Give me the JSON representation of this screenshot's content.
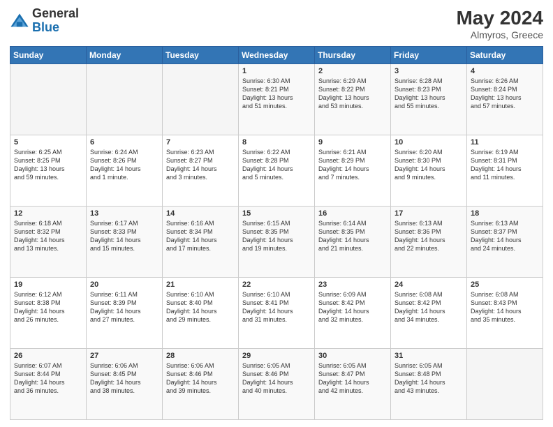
{
  "header": {
    "logo_general": "General",
    "logo_blue": "Blue",
    "title": "May 2024",
    "location": "Almyros, Greece"
  },
  "days_of_week": [
    "Sunday",
    "Monday",
    "Tuesday",
    "Wednesday",
    "Thursday",
    "Friday",
    "Saturday"
  ],
  "weeks": [
    [
      {
        "day": "",
        "info": ""
      },
      {
        "day": "",
        "info": ""
      },
      {
        "day": "",
        "info": ""
      },
      {
        "day": "1",
        "info": "Sunrise: 6:30 AM\nSunset: 8:21 PM\nDaylight: 13 hours\nand 51 minutes."
      },
      {
        "day": "2",
        "info": "Sunrise: 6:29 AM\nSunset: 8:22 PM\nDaylight: 13 hours\nand 53 minutes."
      },
      {
        "day": "3",
        "info": "Sunrise: 6:28 AM\nSunset: 8:23 PM\nDaylight: 13 hours\nand 55 minutes."
      },
      {
        "day": "4",
        "info": "Sunrise: 6:26 AM\nSunset: 8:24 PM\nDaylight: 13 hours\nand 57 minutes."
      }
    ],
    [
      {
        "day": "5",
        "info": "Sunrise: 6:25 AM\nSunset: 8:25 PM\nDaylight: 13 hours\nand 59 minutes."
      },
      {
        "day": "6",
        "info": "Sunrise: 6:24 AM\nSunset: 8:26 PM\nDaylight: 14 hours\nand 1 minute."
      },
      {
        "day": "7",
        "info": "Sunrise: 6:23 AM\nSunset: 8:27 PM\nDaylight: 14 hours\nand 3 minutes."
      },
      {
        "day": "8",
        "info": "Sunrise: 6:22 AM\nSunset: 8:28 PM\nDaylight: 14 hours\nand 5 minutes."
      },
      {
        "day": "9",
        "info": "Sunrise: 6:21 AM\nSunset: 8:29 PM\nDaylight: 14 hours\nand 7 minutes."
      },
      {
        "day": "10",
        "info": "Sunrise: 6:20 AM\nSunset: 8:30 PM\nDaylight: 14 hours\nand 9 minutes."
      },
      {
        "day": "11",
        "info": "Sunrise: 6:19 AM\nSunset: 8:31 PM\nDaylight: 14 hours\nand 11 minutes."
      }
    ],
    [
      {
        "day": "12",
        "info": "Sunrise: 6:18 AM\nSunset: 8:32 PM\nDaylight: 14 hours\nand 13 minutes."
      },
      {
        "day": "13",
        "info": "Sunrise: 6:17 AM\nSunset: 8:33 PM\nDaylight: 14 hours\nand 15 minutes."
      },
      {
        "day": "14",
        "info": "Sunrise: 6:16 AM\nSunset: 8:34 PM\nDaylight: 14 hours\nand 17 minutes."
      },
      {
        "day": "15",
        "info": "Sunrise: 6:15 AM\nSunset: 8:35 PM\nDaylight: 14 hours\nand 19 minutes."
      },
      {
        "day": "16",
        "info": "Sunrise: 6:14 AM\nSunset: 8:35 PM\nDaylight: 14 hours\nand 21 minutes."
      },
      {
        "day": "17",
        "info": "Sunrise: 6:13 AM\nSunset: 8:36 PM\nDaylight: 14 hours\nand 22 minutes."
      },
      {
        "day": "18",
        "info": "Sunrise: 6:13 AM\nSunset: 8:37 PM\nDaylight: 14 hours\nand 24 minutes."
      }
    ],
    [
      {
        "day": "19",
        "info": "Sunrise: 6:12 AM\nSunset: 8:38 PM\nDaylight: 14 hours\nand 26 minutes."
      },
      {
        "day": "20",
        "info": "Sunrise: 6:11 AM\nSunset: 8:39 PM\nDaylight: 14 hours\nand 27 minutes."
      },
      {
        "day": "21",
        "info": "Sunrise: 6:10 AM\nSunset: 8:40 PM\nDaylight: 14 hours\nand 29 minutes."
      },
      {
        "day": "22",
        "info": "Sunrise: 6:10 AM\nSunset: 8:41 PM\nDaylight: 14 hours\nand 31 minutes."
      },
      {
        "day": "23",
        "info": "Sunrise: 6:09 AM\nSunset: 8:42 PM\nDaylight: 14 hours\nand 32 minutes."
      },
      {
        "day": "24",
        "info": "Sunrise: 6:08 AM\nSunset: 8:42 PM\nDaylight: 14 hours\nand 34 minutes."
      },
      {
        "day": "25",
        "info": "Sunrise: 6:08 AM\nSunset: 8:43 PM\nDaylight: 14 hours\nand 35 minutes."
      }
    ],
    [
      {
        "day": "26",
        "info": "Sunrise: 6:07 AM\nSunset: 8:44 PM\nDaylight: 14 hours\nand 36 minutes."
      },
      {
        "day": "27",
        "info": "Sunrise: 6:06 AM\nSunset: 8:45 PM\nDaylight: 14 hours\nand 38 minutes."
      },
      {
        "day": "28",
        "info": "Sunrise: 6:06 AM\nSunset: 8:46 PM\nDaylight: 14 hours\nand 39 minutes."
      },
      {
        "day": "29",
        "info": "Sunrise: 6:05 AM\nSunset: 8:46 PM\nDaylight: 14 hours\nand 40 minutes."
      },
      {
        "day": "30",
        "info": "Sunrise: 6:05 AM\nSunset: 8:47 PM\nDaylight: 14 hours\nand 42 minutes."
      },
      {
        "day": "31",
        "info": "Sunrise: 6:05 AM\nSunset: 8:48 PM\nDaylight: 14 hours\nand 43 minutes."
      },
      {
        "day": "",
        "info": ""
      }
    ]
  ]
}
